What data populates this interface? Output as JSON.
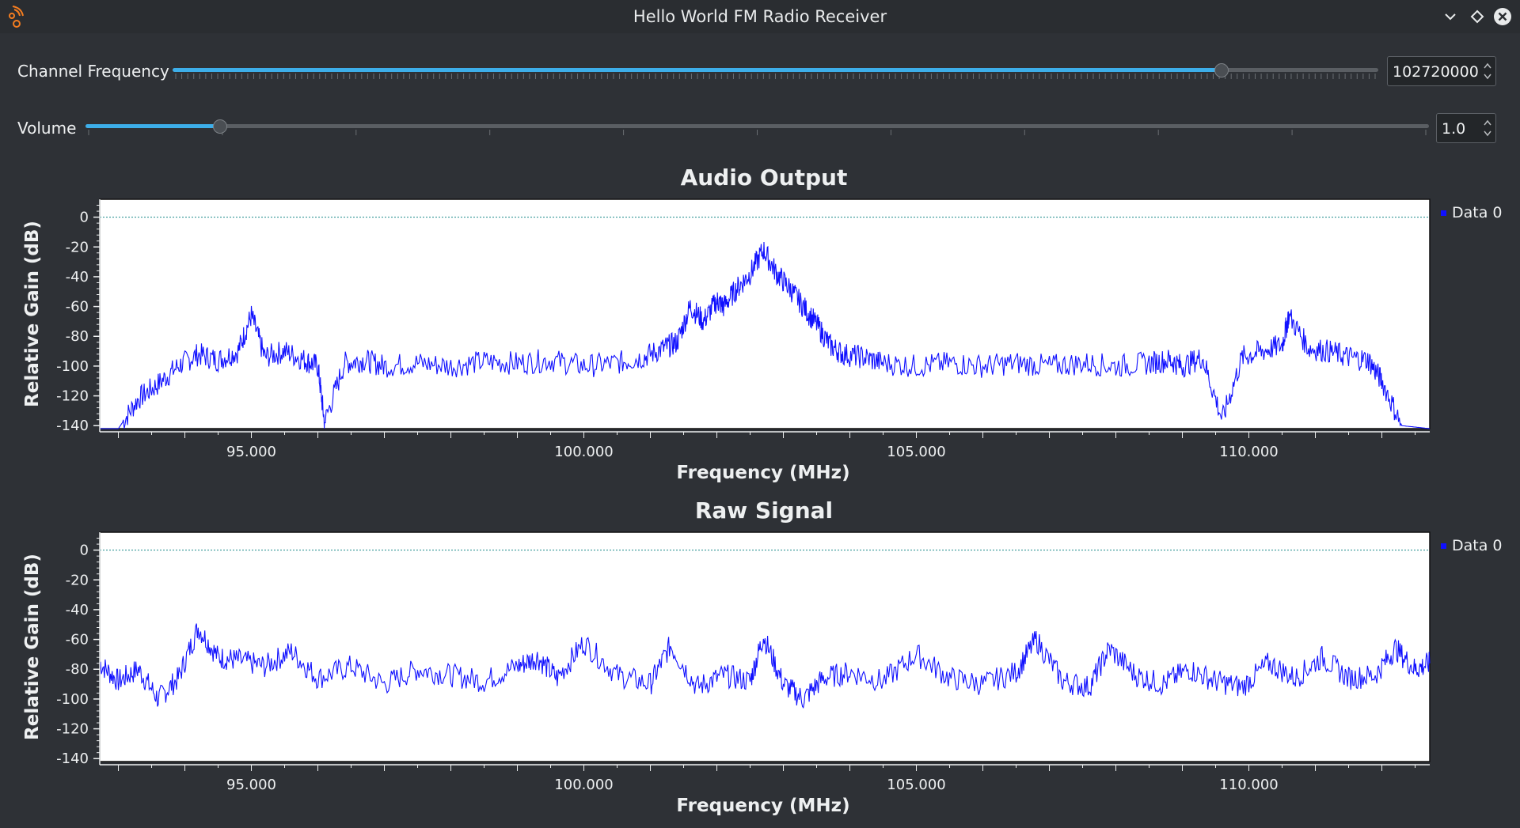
{
  "window": {
    "title": "Hello World FM Radio Receiver"
  },
  "controls": {
    "channel_frequency": {
      "label": "Channel Frequency",
      "value": "102720000",
      "fraction": 0.87
    },
    "volume": {
      "label": "Volume",
      "value": "1.0",
      "fraction": 0.1
    }
  },
  "icons": {
    "app": "gnuradio-icon",
    "minimize": "chevron-down-icon",
    "maximize": "diamond-icon",
    "close": "close-icon"
  },
  "colors": {
    "accent": "#3daee9",
    "series": "#1010ff",
    "reference_line": "#1a8a8a"
  },
  "plots": [
    {
      "title": "Audio Output",
      "xlabel": "Frequency (MHz)",
      "ylabel": "Relative Gain (dB)",
      "legend": "Data 0",
      "xticks": [
        "95.000",
        "100.000",
        "105.000",
        "110.000"
      ],
      "yticks": [
        "0",
        "-20",
        "-40",
        "-60",
        "-80",
        "-100",
        "-120",
        "-140"
      ]
    },
    {
      "title": "Raw Signal",
      "xlabel": "Frequency (MHz)",
      "ylabel": "Relative Gain (dB)",
      "legend": "Data 0",
      "xticks": [
        "95.000",
        "100.000",
        "105.000",
        "110.000"
      ],
      "yticks": [
        "0",
        "-20",
        "-40",
        "-60",
        "-80",
        "-100",
        "-120",
        "-140"
      ]
    }
  ],
  "chart_data": [
    {
      "type": "line",
      "title": "Audio Output",
      "xlabel": "Frequency (MHz)",
      "ylabel": "Relative Gain (dB)",
      "xlim": [
        92.72,
        112.72
      ],
      "ylim": [
        -142,
        12
      ],
      "grid": false,
      "legend_position": "right",
      "reference_line_y": 0,
      "series": [
        {
          "name": "Data 0",
          "x": [
            92.72,
            93.0,
            93.3,
            93.6,
            93.9,
            94.2,
            94.5,
            94.8,
            95.0,
            95.2,
            95.5,
            95.8,
            96.0,
            96.1,
            96.4,
            96.7,
            97.0,
            97.5,
            98.0,
            98.5,
            99.0,
            99.5,
            100.0,
            100.5,
            100.9,
            101.2,
            101.4,
            101.6,
            101.8,
            102.0,
            102.1,
            102.3,
            102.5,
            102.7,
            102.9,
            103.1,
            103.3,
            103.5,
            103.7,
            103.9,
            104.2,
            104.5,
            105.0,
            105.5,
            106.0,
            106.5,
            107.0,
            107.5,
            108.0,
            108.5,
            108.8,
            109.0,
            109.3,
            109.6,
            109.9,
            110.2,
            110.5,
            110.6,
            110.9,
            111.2,
            111.5,
            111.8,
            112.0,
            112.3,
            112.72
          ],
          "y": [
            -142,
            -142,
            -122,
            -112,
            -100,
            -92,
            -96,
            -90,
            -66,
            -94,
            -90,
            -96,
            -100,
            -138,
            -98,
            -96,
            -100,
            -98,
            -100,
            -97,
            -98,
            -96,
            -100,
            -98,
            -94,
            -88,
            -84,
            -60,
            -70,
            -56,
            -60,
            -48,
            -38,
            -22,
            -38,
            -48,
            -60,
            -72,
            -86,
            -92,
            -94,
            -98,
            -100,
            -98,
            -100,
            -98,
            -100,
            -98,
            -100,
            -98,
            -96,
            -100,
            -94,
            -136,
            -94,
            -90,
            -86,
            -66,
            -88,
            -90,
            -94,
            -96,
            -110,
            -140,
            -142
          ]
        }
      ]
    },
    {
      "type": "line",
      "title": "Raw Signal",
      "xlabel": "Frequency (MHz)",
      "ylabel": "Relative Gain (dB)",
      "xlim": [
        92.72,
        112.72
      ],
      "ylim": [
        -142,
        12
      ],
      "grid": false,
      "legend_position": "right",
      "reference_line_y": 0,
      "series": [
        {
          "name": "Data 0",
          "x": [
            92.72,
            93.0,
            93.3,
            93.6,
            93.9,
            94.2,
            94.5,
            94.8,
            95.2,
            95.6,
            96.0,
            96.5,
            97.0,
            97.5,
            98.0,
            98.5,
            99.0,
            99.3,
            99.6,
            100.0,
            100.5,
            101.0,
            101.3,
            101.7,
            102.1,
            102.5,
            102.7,
            103.0,
            103.3,
            103.6,
            104.0,
            104.5,
            105.0,
            105.5,
            106.0,
            106.5,
            106.8,
            107.2,
            107.6,
            107.9,
            108.3,
            108.7,
            109.1,
            109.5,
            109.9,
            110.3,
            110.7,
            111.1,
            111.5,
            111.9,
            112.2,
            112.5,
            112.72
          ],
          "y": [
            -76,
            -88,
            -80,
            -100,
            -86,
            -52,
            -72,
            -74,
            -78,
            -68,
            -86,
            -78,
            -90,
            -80,
            -84,
            -88,
            -78,
            -72,
            -86,
            -62,
            -84,
            -90,
            -64,
            -92,
            -84,
            -88,
            -58,
            -90,
            -100,
            -86,
            -82,
            -88,
            -70,
            -86,
            -90,
            -82,
            -60,
            -88,
            -92,
            -66,
            -84,
            -90,
            -80,
            -88,
            -92,
            -76,
            -86,
            -72,
            -86,
            -84,
            -66,
            -80,
            -76
          ]
        }
      ]
    }
  ]
}
